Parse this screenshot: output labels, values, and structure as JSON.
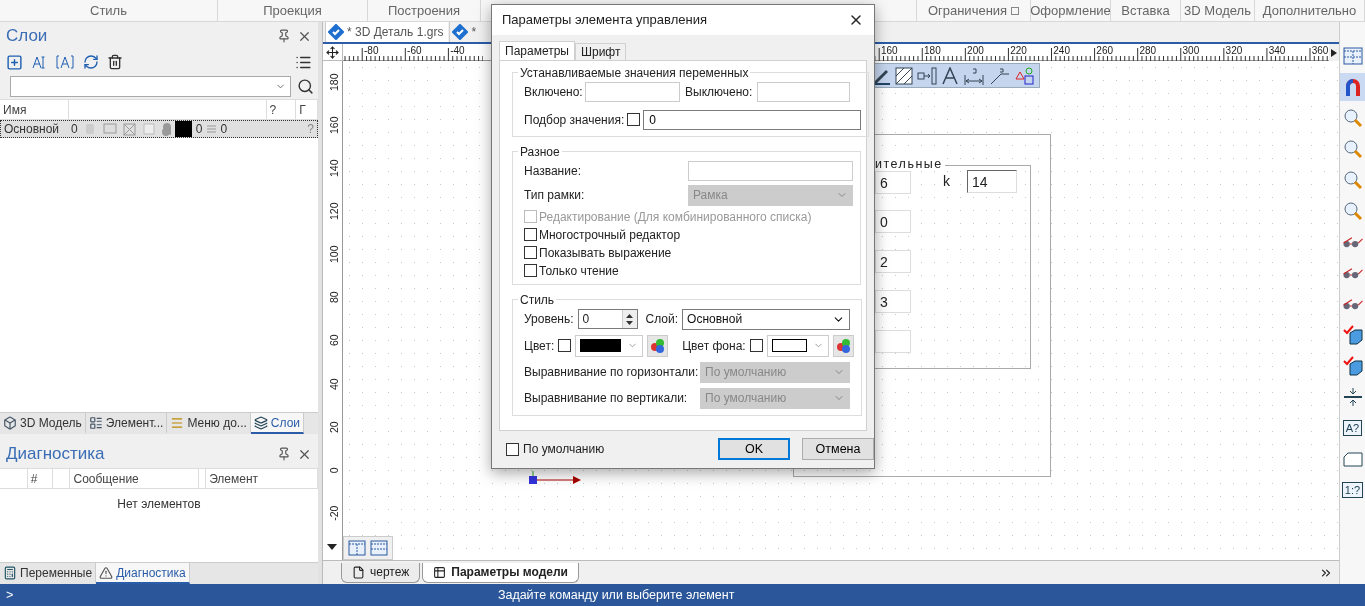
{
  "ribbon_left": [
    {
      "label": "Стиль"
    },
    {
      "label": "Проекция"
    },
    {
      "label": "Построения"
    }
  ],
  "ribbon_right": [
    {
      "label": "Ограничения",
      "launcher": true
    },
    {
      "label": "Оформление",
      "launcher": false
    },
    {
      "label": "Вставка",
      "launcher": false
    },
    {
      "label": "3D Модель",
      "launcher": false
    },
    {
      "label": "Дополнительно",
      "launcher": false
    }
  ],
  "layers_panel": {
    "title": "Слои",
    "columns": [
      {
        "label": "Имя"
      },
      {
        "label": "?"
      },
      {
        "label": "Г"
      }
    ],
    "rows": [
      {
        "name": "Основной",
        "selected": true,
        "color": "#000000",
        "values": [
          "0",
          "0",
          "0"
        ],
        "hint": "?"
      }
    ],
    "tabs": [
      {
        "label": "3D Модель",
        "kind": "model",
        "selected": false
      },
      {
        "label": "Элемент...",
        "kind": "elements",
        "selected": false
      },
      {
        "label": "Меню до...",
        "kind": "menu",
        "selected": false
      },
      {
        "label": "Слои",
        "kind": "layers",
        "selected": true
      }
    ]
  },
  "diagnostics_panel": {
    "title": "Диагностика",
    "columns": [
      {
        "label": "#"
      },
      {
        "label": "Сообщение"
      },
      {
        "label": "Элемент"
      }
    ],
    "empty_text": "Нет элементов",
    "tabs": [
      {
        "label": "Переменные",
        "kind": "variables",
        "selected": false
      },
      {
        "label": "Диагностика",
        "kind": "warning",
        "selected": true
      }
    ]
  },
  "document_tabs": [
    {
      "label": "* 3D Деталь 1.grs",
      "selected": true
    },
    {
      "label": "*",
      "selected": false
    }
  ],
  "top_ruler": [
    "-80",
    "-60",
    "-40",
    "160",
    "180",
    "200",
    "220",
    "240",
    "260",
    "280",
    "300",
    "320",
    "340",
    "360"
  ],
  "left_ruler": [
    "180",
    "160",
    "140",
    "120",
    "100",
    "80",
    "60",
    "40",
    "20",
    "0",
    "-20"
  ],
  "canvas": {
    "group_legend": "ительные",
    "fields": [
      {
        "kind": "filled",
        "value": "6"
      },
      {
        "kind": "filled",
        "value": "0"
      },
      {
        "kind": "filled",
        "value": "2"
      },
      {
        "kind": "filled",
        "value": "3"
      },
      {
        "kind": "blank"
      }
    ],
    "k_label": "k",
    "k_value": "14"
  },
  "sheet_tabs": [
    {
      "label": "чертеж",
      "selected": false
    },
    {
      "label": "Параметры модели",
      "selected": true
    }
  ],
  "right_toolbar": [
    {
      "kind": "grid",
      "selected": false
    },
    {
      "kind": "magnet",
      "selected": true
    },
    {
      "kind": "zoom-page",
      "selected": false
    },
    {
      "kind": "zoom-window",
      "selected": false
    },
    {
      "kind": "zoom-frame",
      "selected": false
    },
    {
      "kind": "zoom-prev",
      "selected": false
    },
    {
      "kind": "glasses-dash",
      "selected": false
    },
    {
      "kind": "glasses-angle",
      "selected": false
    },
    {
      "kind": "glasses-corner",
      "selected": false
    },
    {
      "kind": "check-cube",
      "selected": false
    },
    {
      "kind": "double-check-cube",
      "selected": false
    },
    {
      "kind": "compress",
      "selected": false
    },
    {
      "kind": "text-query",
      "label": "A?",
      "selected": false
    },
    {
      "kind": "sheet",
      "selected": false
    },
    {
      "kind": "scale-query",
      "label": "1:?",
      "selected": false
    }
  ],
  "status_bar": {
    "prompt": ">",
    "message": "Задайте команду или выберите элемент"
  },
  "dialog": {
    "title": "Параметры элемента управления",
    "tabs": [
      {
        "label": "Параметры",
        "selected": true
      },
      {
        "label": "Шрифт",
        "selected": false
      }
    ],
    "variables_group": {
      "title": "Устанавливаемые значения переменных",
      "on_label": "Включено:",
      "off_label": "Выключено:",
      "pick_label": "Подбор значения:",
      "pick_checked": false,
      "pick_value": "0"
    },
    "misc_group": {
      "title": "Разное",
      "name_label": "Название:",
      "frame_label": "Тип рамки:",
      "frame_value": "Рамка",
      "frame_disabled": true,
      "options": [
        {
          "label": "Редактирование (Для комбинированного списка)",
          "checked": false,
          "disabled": true
        },
        {
          "label": "Многострочный редактор",
          "checked": false,
          "disabled": false
        },
        {
          "label": "Показывать выражение",
          "checked": false,
          "disabled": false
        },
        {
          "label": "Только чтение",
          "checked": false,
          "disabled": false
        }
      ]
    },
    "style_group": {
      "title": "Стиль",
      "level_label": "Уровень:",
      "level_value": "0",
      "layer_label": "Слой:",
      "layer_value": "Основной",
      "colors": [
        {
          "label": "Цвет:",
          "checked": false,
          "color": "#000000"
        },
        {
          "label": "Цвет фона:",
          "checked": false,
          "color": "#ffffff"
        }
      ],
      "aligns": [
        {
          "label": "Выравнивание по горизонтали:",
          "value": "По умолчанию",
          "disabled": true
        },
        {
          "label": "Выравнивание по вертикали:",
          "value": "По умолчанию",
          "disabled": true
        }
      ]
    },
    "default_label": "По умолчанию",
    "default_checked": false,
    "ok": "OK",
    "cancel": "Отмена"
  }
}
